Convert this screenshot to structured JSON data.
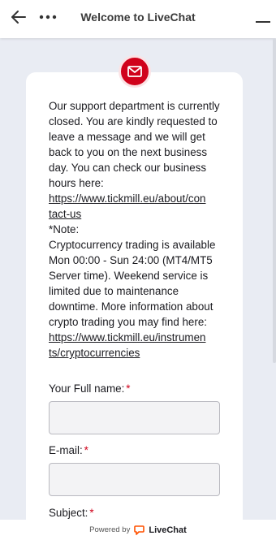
{
  "header": {
    "title": "Welcome to LiveChat",
    "back_icon": "arrow-left-icon",
    "more_icon": "more-dots-icon",
    "minimize_icon": "minimize-icon"
  },
  "message": {
    "line1": "Our support department is currently closed. You are kindly requested to leave a message and we will get back to you on the next business day. You can check our business hours here:",
    "link1": "https://www.tickmill.eu/about/contact-us",
    "note_label": "*Note:",
    "line2": "Cryptocurrency trading is available Mon 00:00 - Sun 24:00 (MT4/MT5 Server time). Weekend service is limited due to maintenance downtime. More information about crypto trading you may find here:",
    "link2": "https://www.tickmill.eu/instruments/cryptocurrencies"
  },
  "form": {
    "full_name_label": "Your Full name:",
    "email_label": "E-mail:",
    "subject_label": "Subject:",
    "required_mark": "*",
    "full_name_value": "",
    "email_value": ""
  },
  "footer": {
    "powered_by": "Powered by",
    "brand": "LiveChat"
  },
  "colors": {
    "accent": "#d0021b",
    "background": "#e9ecf3"
  }
}
